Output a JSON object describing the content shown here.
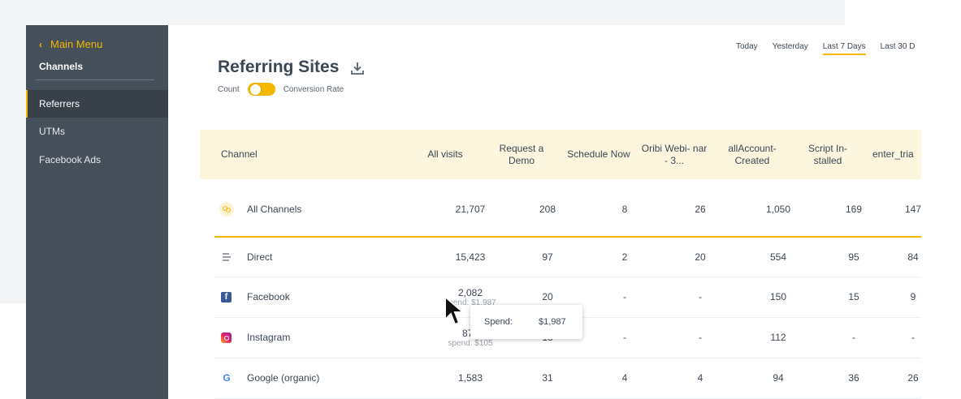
{
  "sidebar": {
    "back_label": "Main Menu",
    "section_title": "Channels",
    "items": [
      {
        "label": "Referrers",
        "active": true
      },
      {
        "label": "UTMs",
        "active": false
      },
      {
        "label": "Facebook Ads",
        "active": false
      }
    ]
  },
  "header": {
    "title": "Referring Sites",
    "toggle_left_label": "Count",
    "toggle_right_label": "Conversion Rate",
    "date_tabs": [
      "Today",
      "Yesterday",
      "Last 7 Days",
      "Last 30 D"
    ],
    "selected_date_tab": "Last 7 Days"
  },
  "table": {
    "columns": [
      "Channel",
      "All visits",
      "Request a Demo",
      "Schedule Now",
      "Oribi Webi- nar - 3...",
      "allAccount- Created",
      "Script In- stalled",
      "enter_tria"
    ],
    "rows": [
      {
        "channel": "All Channels",
        "icon": "all-channels-icon",
        "values": [
          "21,707",
          "208",
          "8",
          "26",
          "1,050",
          "169",
          "147"
        ]
      },
      {
        "channel": "Direct",
        "icon": "direct-icon",
        "values": [
          "15,423",
          "97",
          "2",
          "20",
          "554",
          "95",
          "84"
        ]
      },
      {
        "channel": "Facebook",
        "icon": "facebook-icon",
        "values": [
          "2,082",
          "20",
          "-",
          "-",
          "150",
          "15",
          "9"
        ],
        "spend_sub": "spend: $1,987"
      },
      {
        "channel": "Instagram",
        "icon": "instagram-icon",
        "values": [
          "876",
          "13",
          "-",
          "-",
          "112",
          "-",
          "-"
        ],
        "spend_sub": "spend: $105"
      },
      {
        "channel": "Google (organic)",
        "icon": "google-icon",
        "values": [
          "1,583",
          "31",
          "4",
          "4",
          "94",
          "36",
          "26"
        ]
      }
    ]
  },
  "tooltip": {
    "label": "Spend:",
    "value": "$1,987"
  },
  "colors": {
    "accent": "#f5b800",
    "sidebar": "#46505b",
    "header_bg": "#fdf6df"
  }
}
